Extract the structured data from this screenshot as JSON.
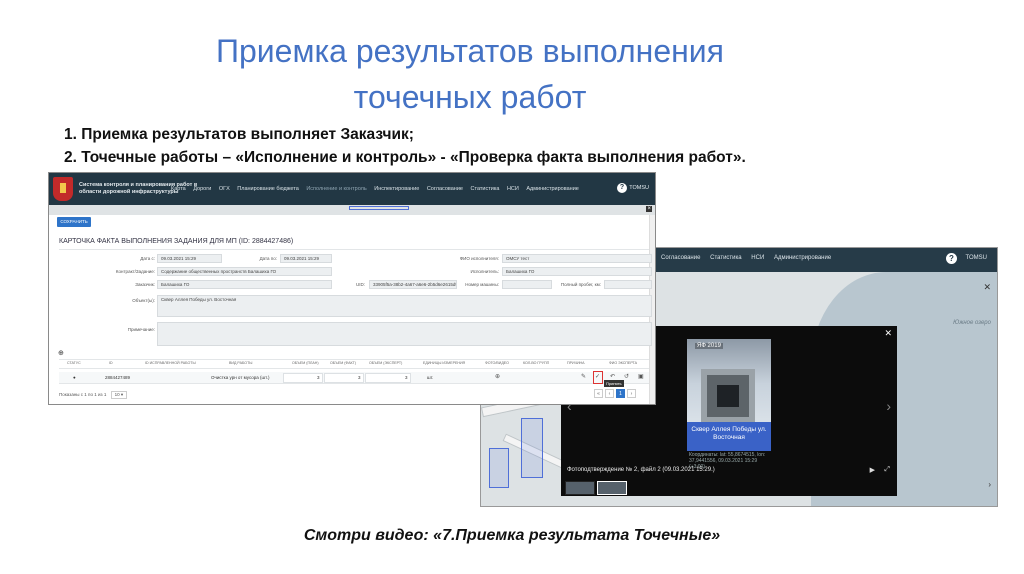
{
  "slide": {
    "title_line1": "Приемка результатов выполнения",
    "title_line2": "точечных работ",
    "bullet1": "1. Приемка результатов выполняет Заказчик;",
    "bullet2": "2. Точечные работы – «Исполнение и контроль» -  «Проверка факта выполнения работ».",
    "caption": "Смотри видео: «7.Приемка результата Точечные»"
  },
  "app": {
    "system_name": "Система контроля и планирования работ в области дорожной инфраструктуры",
    "nav": [
      "Карта",
      "Дороги",
      "ОГХ",
      "Планирование бюджета",
      "Исполнение и контроль",
      "Инспектирование",
      "Согласование",
      "Статистика",
      "НСИ",
      "Администрирование"
    ],
    "user": "TOMSU",
    "save_button": "СОХРАНИТЬ",
    "card_title": "КАРТОЧКА ФАКТА ВЫПОЛНЕНИЯ ЗАДАНИЯ ДЛЯ МП (ID: 2884427486)",
    "fields": {
      "date_from_label": "Дата с:",
      "date_from": "09.03.2021 15:29",
      "date_to_label": "Дата по:",
      "date_to": "09.03.2021 15:29",
      "executor_fio_label": "ФИО исполнителя:",
      "executor_fio": "ОМСУ тест",
      "contract_label": "Контракт/Задание:",
      "contract": "Содержание общественных пространств Балашиха ГО",
      "executor_label": "Исполнитель:",
      "executor": "Балашиха ГО",
      "customer_label": "Заказчик:",
      "customer": "Балашиха ГО",
      "uid_label": "UID:",
      "uid": "33905f5a-38b2-4a67-a6e6-2b5d6e2615d9",
      "machine_label": "Номер машины:",
      "machine": "",
      "mileage_label": "Полный пробег, км:",
      "mileage": "",
      "object_label": "Объект(ы):",
      "object": "Сквер Аллея Победы ул. Восточная",
      "note_label": "Примечание:",
      "note": ""
    },
    "table": {
      "headers": [
        "СТАТУС",
        "ID",
        "ID ИСПРАВЛЕННОЙ РАБОТЫ",
        "ВИД РАБОТЫ",
        "ОБЪЕМ (ПЛАН)",
        "ОБЪЕМ (ФАКТ)",
        "ОБЪЕМ (ЭКСПЕРТ)",
        "ЕДИНИЦЫ ИЗМЕРЕНИЯ",
        "ФОТО/ВИДЕО",
        "КОЛ-ВО ГРУПП",
        "ПРИЧИНА",
        "ФИО ЭКСПЕРТА"
      ],
      "row": {
        "id": "2884427489",
        "work_type": "Очистка урн от мусора (шт.)",
        "plan": "3",
        "fact": "3",
        "expert": "3",
        "unit": "шт."
      },
      "accept_tooltip": "Принять",
      "pager_text": "Показаны с 1 по 1 из 1",
      "page_size": "10",
      "current_page": "1"
    }
  },
  "viewer": {
    "top_menu": [
      "Согласование",
      "Статистика",
      "НСИ",
      "Администрирование"
    ],
    "user": "TOMSU",
    "map_label": "Южное озеро",
    "photo_tag": "ЯФ 2019",
    "photo_place": "Сквер Аллея Победы ул. Восточная",
    "photo_coords": "Координаты: lat: 55,8674515, lon: 37,9441556, 09.03.2021 15:29 (+3:00)",
    "caption": "Фотоподтверждение № 2, файл 2 (09.03.2021 15:29.)"
  }
}
